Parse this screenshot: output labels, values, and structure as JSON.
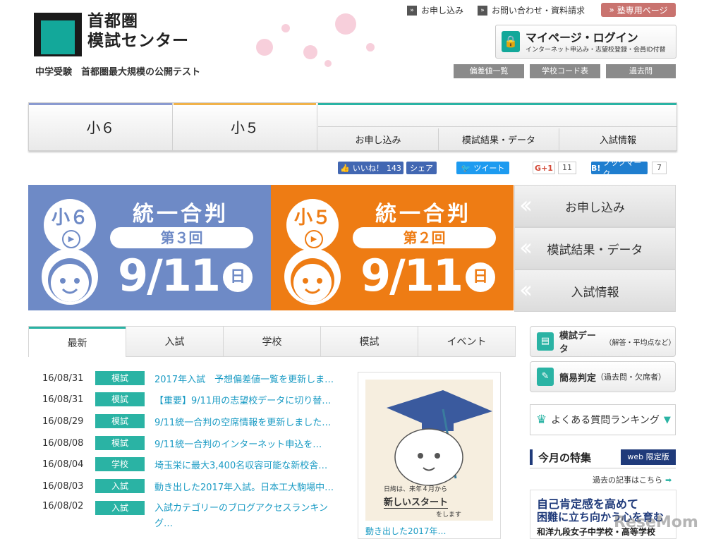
{
  "header": {
    "logo_text_line1": "首都圏",
    "logo_text_line2": "模試センター",
    "tagline": "中学受験　首都圏最大規模の公開テスト",
    "links": [
      "お申し込み",
      "お問い合わせ・資料請求"
    ],
    "juku_label": "塾専用ページ",
    "mypage_title": "マイページ・ログイン",
    "mypage_sub": "インターネット申込み・志望校登録・会員ID付替",
    "quick_buttons": [
      "偏差値一覧",
      "学校コード表",
      "過去問"
    ]
  },
  "nav": {
    "tab1": "小６",
    "tab2": "小５",
    "sub": [
      "お申し込み",
      "模試結果・データ",
      "入試情報"
    ],
    "colors": {
      "tab1": "#8a9ad0",
      "tab2": "#f0b24a",
      "tab3": "#2ab3a4"
    }
  },
  "social": {
    "like_label": "いいね！",
    "like_count": "143",
    "share_label": "シェア",
    "tweet_label": "ツイート",
    "gplus_label": "G+1",
    "gplus_count": "11",
    "bookmark_label": "ブックマーク",
    "bookmark_count": "7"
  },
  "banners": [
    {
      "grade": "小６",
      "title": "統一合判",
      "round": "第３回",
      "date": "9/11",
      "day": "日",
      "color": "#6e8ac6"
    },
    {
      "grade": "小５",
      "title": "統一合判",
      "round": "第２回",
      "date": "9/11",
      "day": "日",
      "color": "#ee7c14"
    }
  ],
  "right_buttons": [
    "お申し込み",
    "模試結果・データ",
    "入試情報"
  ],
  "news": {
    "tabs": [
      "最新",
      "入試",
      "学校",
      "模試",
      "イベント"
    ],
    "items": [
      {
        "date": "16/08/31",
        "cat": "模試",
        "text": "2017年入試　予想偏差値一覧を更新しま…"
      },
      {
        "date": "16/08/31",
        "cat": "模試",
        "text": "【重要】9/11用の志望校データに切り替…"
      },
      {
        "date": "16/08/29",
        "cat": "模試",
        "text": "9/11統一合判の空席情報を更新しました…"
      },
      {
        "date": "16/08/08",
        "cat": "模試",
        "text": "9/11統一合判のインターネット申込を…"
      },
      {
        "date": "16/08/04",
        "cat": "学校",
        "text": "埼玉栄に最大3,400名収容可能な新校舎…"
      },
      {
        "date": "16/08/03",
        "cat": "入試",
        "text": "動き出した2017年入試。日本工大駒場中…"
      },
      {
        "date": "16/08/02",
        "cat": "入試",
        "text": "入試カテゴリーのブログアクセスランキング…"
      }
    ]
  },
  "feature": {
    "illus_text_top": "日絢は、来年４月から",
    "illus_text_mid": "新しいスタート",
    "illus_text_bot": "をします",
    "caption": "動き出した2017年…"
  },
  "sidebar": {
    "data_title": "模試データ",
    "data_sub": "（解答・平均点など）",
    "judge_title": "簡易判定",
    "judge_sub": "（過去問・欠席者）",
    "faq": "よくある質問ランキング",
    "special_title": "今月の特集",
    "web_badge": "web 限定版",
    "past_link": "過去の記事はこちら",
    "ad_line1": "自己肯定感を高めて",
    "ad_line2": "困難に立ち向かう心を育む",
    "ad_line3": "和洋九段女子中学校・高等学校"
  },
  "watermark": "ReseMom"
}
